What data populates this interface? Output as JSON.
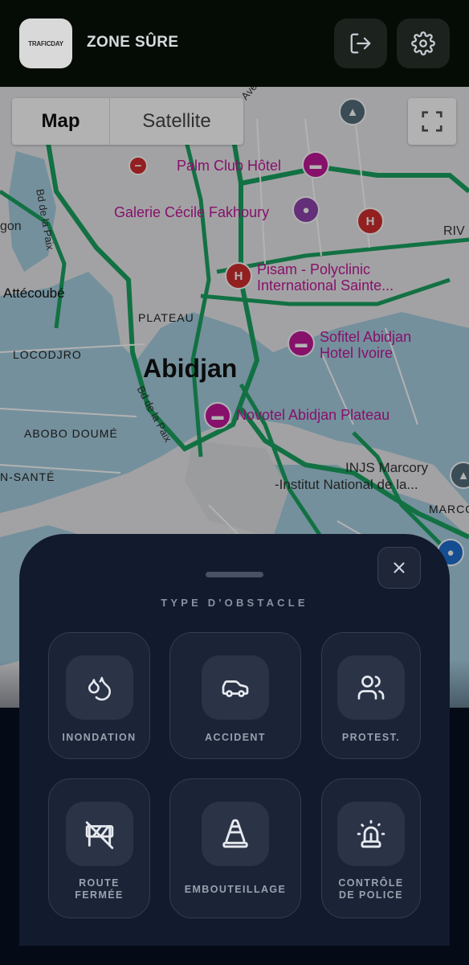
{
  "header": {
    "logo_text": "TRAFICDAY",
    "title": "ZONE SÛRE",
    "logout_icon": "logout-icon",
    "settings_icon": "gear-icon"
  },
  "map": {
    "toggle": {
      "map_label": "Map",
      "satellite_label": "Satellite"
    },
    "fullscreen_icon": "fullscreen-icon",
    "city": "Abidjan",
    "pois": {
      "palm_club": "Palm Club Hôtel",
      "galerie": "Galerie Cécile Fakhoury",
      "pisam_line1": "Pisam - Polyclinic",
      "pisam_line2": "International Sainte...",
      "sofitel_line1": "Sofitel Abidjan",
      "sofitel_line2": "Hotel Ivoire",
      "novotel": "Novotel Abidjan Plateau",
      "injs_line1": "INJS Marcory",
      "injs_line2": "-Institut National de la..."
    },
    "districts": {
      "attecoube": "Attécoubé",
      "plateau": "PLATEAU",
      "locodjro": "LOCODJRO",
      "abobo_doume": "ABOBO DOUMÉ",
      "sante": "N-SANTÉ",
      "gon": "gon",
      "marco": "MARCO",
      "riv": "RIV"
    },
    "roads": {
      "bd_paix_1": "Bd de la Paix",
      "bd_paix_2": "Bd de la Paix",
      "ave": "Ave"
    },
    "pin_letters": {
      "hospital": "H"
    }
  },
  "sheet": {
    "title": "TYPE D'OBSTACLE",
    "close_icon": "close-icon",
    "types": [
      {
        "label": "INONDATION",
        "icon": "droplets-icon"
      },
      {
        "label": "ACCIDENT",
        "icon": "car-icon"
      },
      {
        "label": "PROTEST.",
        "icon": "users-icon"
      },
      {
        "label_line1": "ROUTE",
        "label_line2": "FERMÉE",
        "icon": "road-barrier-icon"
      },
      {
        "label": "EMBOUTEILLAGE",
        "icon": "traffic-cone-icon"
      },
      {
        "label_line1": "CONTRÔLE",
        "label_line2": "DE POLICE",
        "icon": "siren-icon"
      }
    ]
  }
}
